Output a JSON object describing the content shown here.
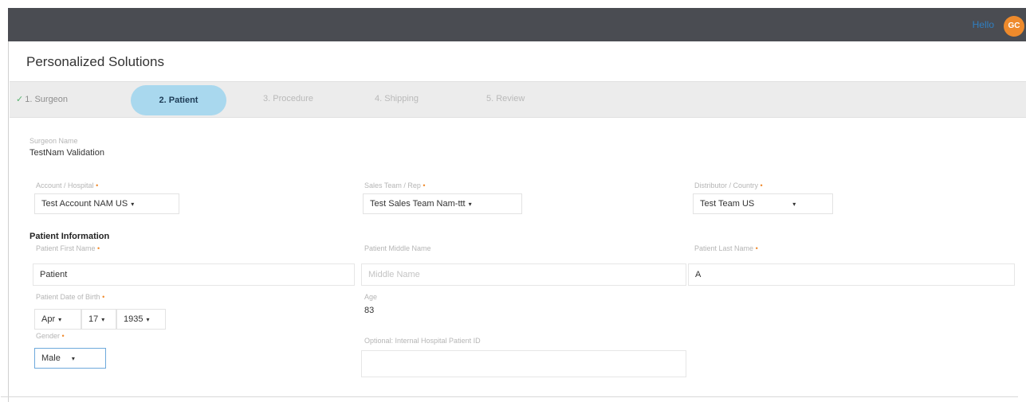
{
  "header": {
    "user_name": "Hello",
    "avatar_initials": "GC"
  },
  "page": {
    "title": "Personalized Solutions"
  },
  "steps": [
    {
      "label": "1. Surgeon",
      "state": "done"
    },
    {
      "label": "2. Patient",
      "state": "active"
    },
    {
      "label": "3. Procedure",
      "state": "pending"
    },
    {
      "label": "4. Shipping",
      "state": "pending"
    },
    {
      "label": "5. Review",
      "state": "pending"
    }
  ],
  "surgeon": {
    "label": "Surgeon Name",
    "value": "TestNam Validation"
  },
  "account": {
    "label": "Account / Hospital",
    "value": "Test Account NAM US"
  },
  "sales": {
    "label": "Sales Team / Rep",
    "value": "Test Sales Team Nam-ttt"
  },
  "distributor": {
    "label": "Distributor / Country",
    "value": "Test Team US"
  },
  "patient_info": {
    "title": "Patient Information"
  },
  "first_name": {
    "label": "Patient First Name",
    "value": "Patient"
  },
  "middle_name": {
    "label": "Patient Middle Name",
    "placeholder": "Middle Name"
  },
  "last_name": {
    "label": "Patient Last Name",
    "value": "A"
  },
  "dob": {
    "label": "Patient Date of Birth",
    "month": "Apr",
    "day": "17",
    "year": "1935"
  },
  "age": {
    "label": "Age",
    "value": "83"
  },
  "gender": {
    "label": "Gender",
    "value": "Male"
  },
  "internal_id": {
    "label": "Optional: Internal Hospital Patient ID",
    "value": ""
  },
  "required_marker": "•",
  "check_glyph": "✓",
  "caret_glyph": "▾",
  "colors": {
    "accent": "#a9d8ee",
    "required": "#ef8a2d",
    "topbar": "#4a4c52",
    "avatar": "#ee8a2c"
  }
}
